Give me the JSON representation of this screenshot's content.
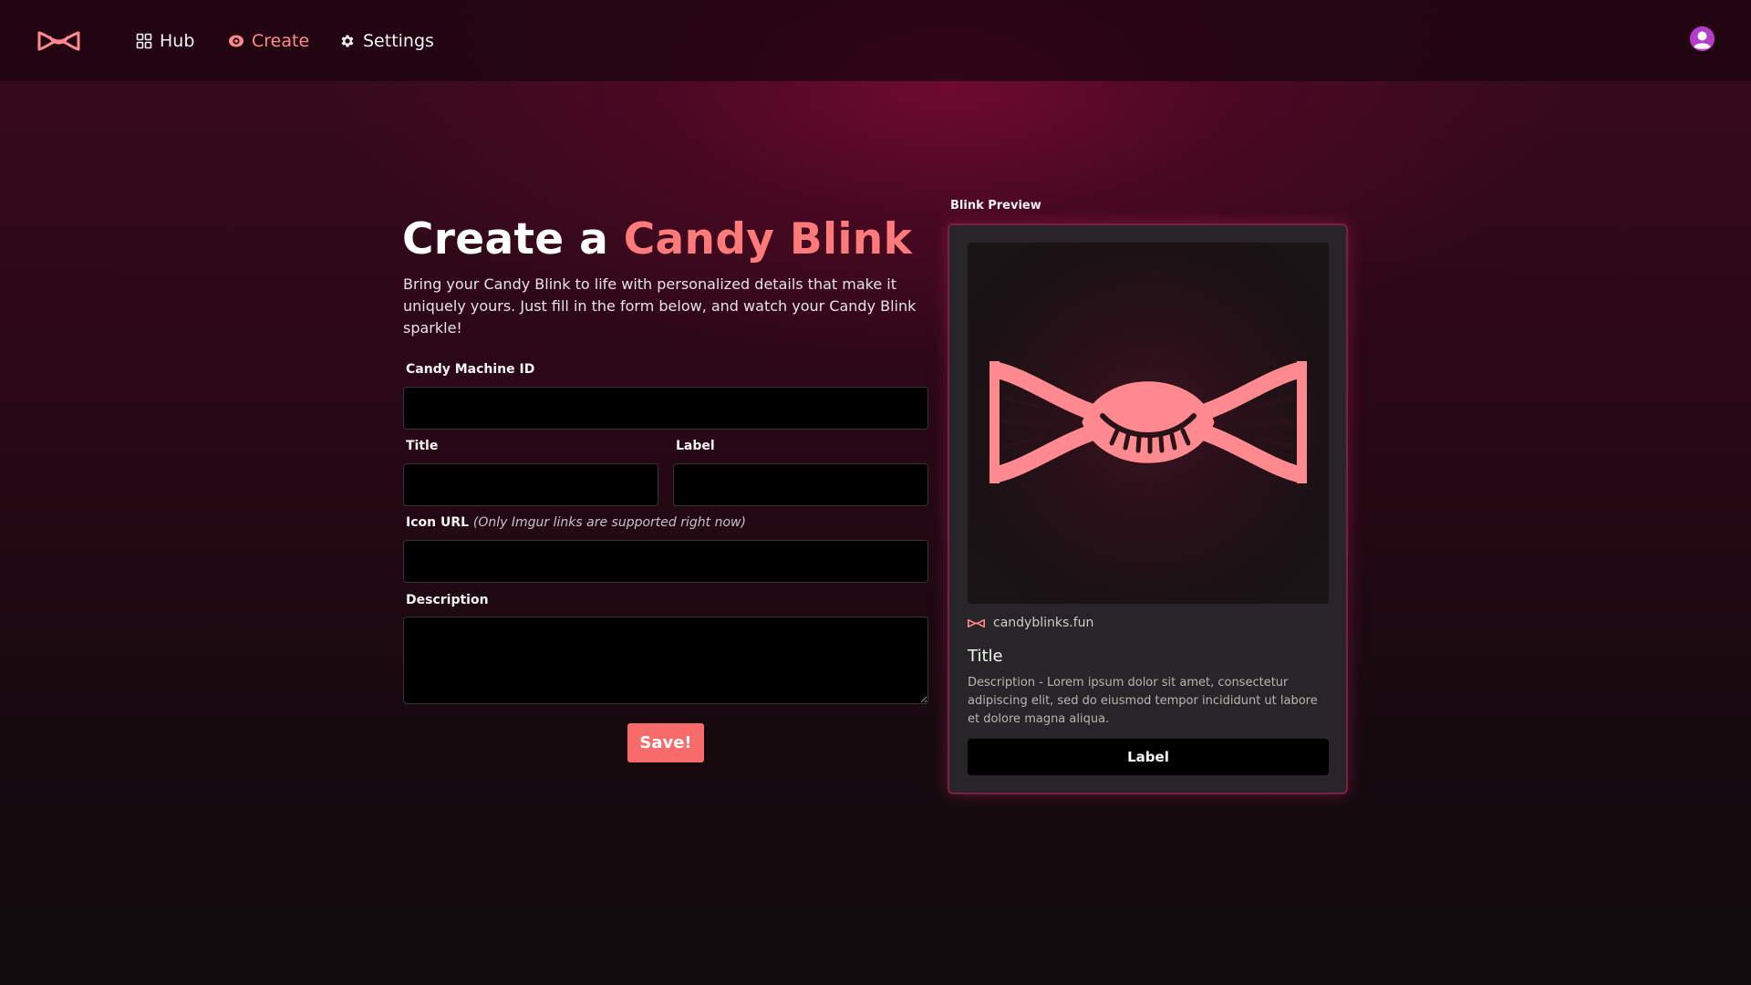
{
  "nav": {
    "logo_icon": "candy-logo",
    "items": [
      {
        "label": "Hub",
        "icon": "grid-icon",
        "active": false
      },
      {
        "label": "Create",
        "icon": "eye-icon",
        "active": true
      },
      {
        "label": "Settings",
        "icon": "gear-icon",
        "active": false
      }
    ],
    "avatar_icon": "user-avatar-icon"
  },
  "form": {
    "heading_prefix": "Create a ",
    "heading_accent": "Candy Blink",
    "intro": "Bring your Candy Blink to life with personalized details that make it uniquely yours. Just fill in the form below, and watch your Candy Blink sparkle!",
    "fields": {
      "candy_machine_id": {
        "label": "Candy Machine ID",
        "value": "",
        "placeholder": ""
      },
      "title": {
        "label": "Title",
        "value": "",
        "placeholder": ""
      },
      "label": {
        "label": "Label",
        "value": "",
        "placeholder": ""
      },
      "icon_url": {
        "label": "Icon URL",
        "hint": "(Only Imgur links are supported right now)",
        "value": "",
        "placeholder": ""
      },
      "description": {
        "label": "Description",
        "value": "",
        "placeholder": ""
      }
    },
    "save_label": "Save!"
  },
  "preview": {
    "caption": "Blink Preview",
    "image_icon": "candy-eye-logo",
    "domain": "candyblinks.fun",
    "title": "Title",
    "description": "Description - Lorem ipsum dolor sit amet, consectetur adipiscing elit, sed do eiusmod tempor incididunt ut labore et dolore magna aliqua.",
    "button_label": "Label"
  },
  "colors": {
    "accent": "#ff7b7b",
    "save_button": "#f76b6b",
    "card_border": "#7a2040",
    "avatar": "#b43cc9"
  }
}
